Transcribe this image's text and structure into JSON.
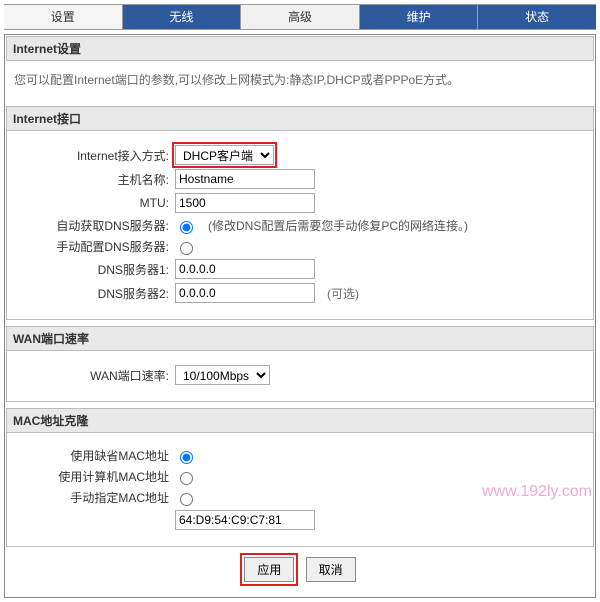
{
  "tabs": {
    "t0": "设置",
    "t1": "无线",
    "t2": "高级",
    "t3": "维护",
    "t4": "状态"
  },
  "internet_settings": {
    "title": "Internet设置",
    "desc": "您可以配置Internet端口的参数,可以修改上网模式为:静态IP,DHCP或者PPPoE方式。"
  },
  "internet_interface": {
    "title": "Internet接口",
    "access_mode_label": "Internet接入方式:",
    "access_mode_value": "DHCP客户端",
    "hostname_label": "主机名称:",
    "hostname_value": "Hostname",
    "mtu_label": "MTU:",
    "mtu_value": "1500",
    "dns_auto_label": "自动获取DNS服务器:",
    "dns_auto_note": "(修改DNS配置后需要您手动修复PC的网络连接。)",
    "dns_manual_label": "手动配置DNS服务器:",
    "dns1_label": "DNS服务器1:",
    "dns1_value": "0.0.0.0",
    "dns2_label": "DNS服务器2:",
    "dns2_value": "0.0.0.0",
    "dns2_optional": "(可选)"
  },
  "wan_rate": {
    "title": "WAN端口速率",
    "label": "WAN端口速率:",
    "value": "10/100Mbps"
  },
  "mac_clone": {
    "title": "MAC地址克隆",
    "opt_default": "使用缺省MAC地址",
    "opt_pc": "使用计算机MAC地址",
    "opt_manual": "手动指定MAC地址",
    "mac_value": "64:D9:54:C9:C7:81"
  },
  "buttons": {
    "apply": "应用",
    "cancel": "取消"
  },
  "watermark": "www.192ly.com"
}
